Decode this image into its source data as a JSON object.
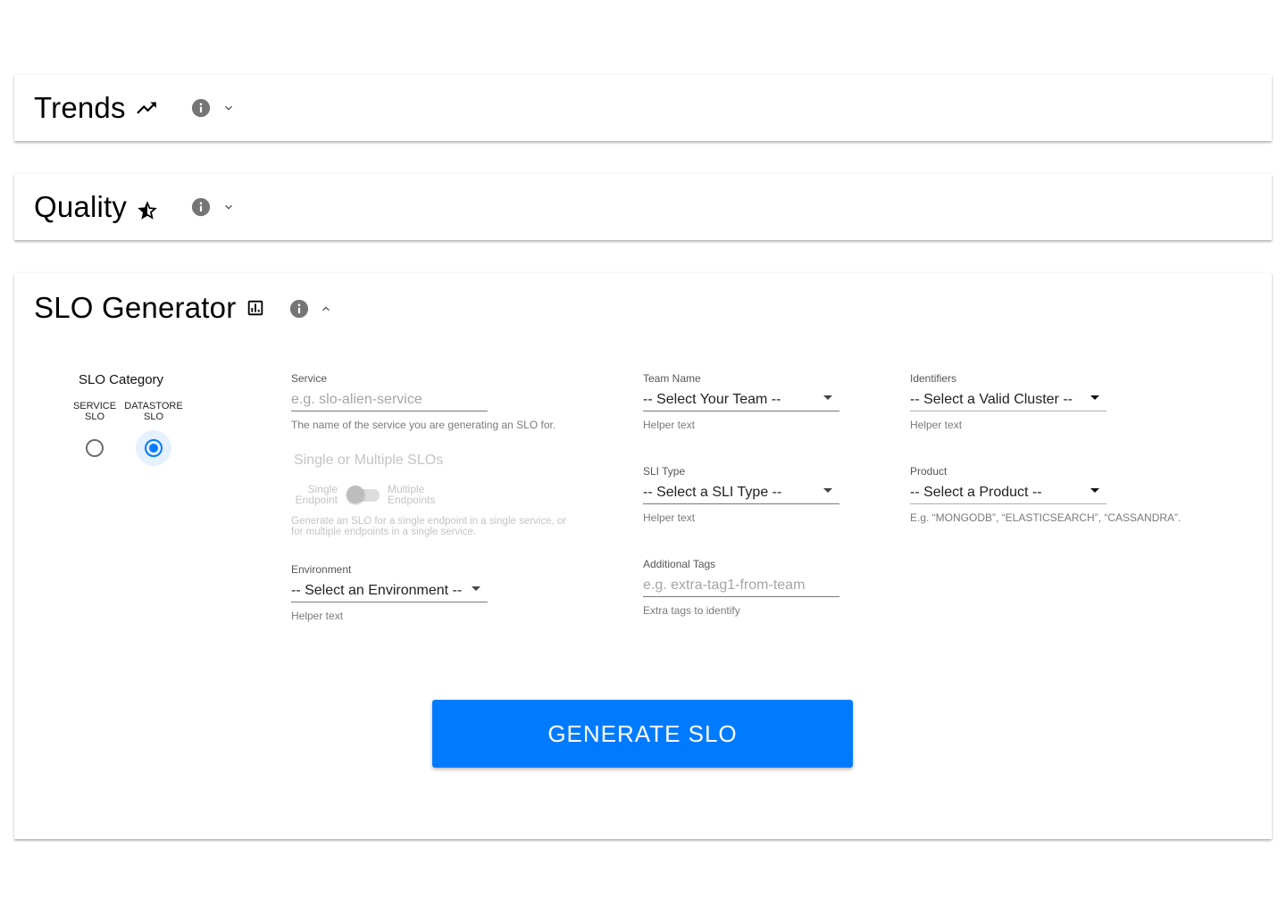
{
  "sections": {
    "trends": {
      "title": "Trends",
      "icon": "trending-up-icon"
    },
    "quality": {
      "title": "Quality",
      "icon": "star-half-icon"
    },
    "slo_generator": {
      "title": "SLO Generator",
      "icon": "chart-box-icon"
    }
  },
  "slo_category": {
    "label": "SLO Category",
    "options": [
      {
        "line1": "SERVICE",
        "line2": "SLO",
        "selected": false
      },
      {
        "line1": "DATASTORE",
        "line2": "SLO",
        "selected": true
      }
    ]
  },
  "service": {
    "label": "Service",
    "placeholder": "e.g. slo-alien-service",
    "helper": "The name of the service you are generating an SLO for."
  },
  "single_multiple": {
    "label": "Single or Multiple SLOs",
    "left_line1": "Single",
    "left_line2": "Endpoint",
    "right_line1": "Multiple",
    "right_line2": "Endpoints",
    "helper_line1": "Generate an SLO for a single endpoint in a single service, or",
    "helper_line2": "for multiple endpoints in a single service."
  },
  "environment": {
    "label": "Environment",
    "value": "-- Select an Environment --",
    "helper": "Helper text"
  },
  "team_name": {
    "label": "Team Name",
    "value": "-- Select Your Team --",
    "helper": "Helper text"
  },
  "sli_type": {
    "label": "SLI Type",
    "value": "-- Select a SLI Type --",
    "helper": "Helper text"
  },
  "additional_tags": {
    "label": "Additional Tags",
    "placeholder": "e.g. extra-tag1-from-team",
    "helper": "Extra tags to identify"
  },
  "identifiers": {
    "label": "Identifiers",
    "value": "-- Select a Valid Cluster --",
    "helper": "Helper text"
  },
  "product": {
    "label": "Product",
    "value": "-- Select a Product --",
    "helper": "E.g. “MONGODB”, “ELASTICSEARCH”, “CASSANDRA”."
  },
  "generate_button": {
    "label": "GENERATE SLO"
  },
  "colors": {
    "accent": "#007bff",
    "info_icon": "#757575"
  }
}
